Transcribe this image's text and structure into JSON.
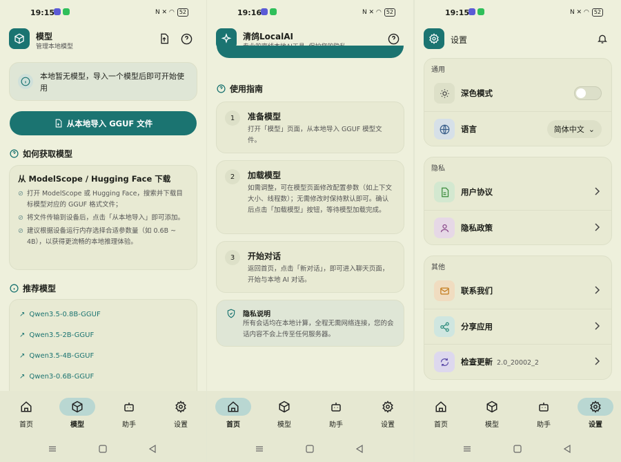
{
  "status": {
    "left_time": "19:15",
    "mid_time": "19:16",
    "right_time": "19:15",
    "battery": "52"
  },
  "screen1": {
    "title": "模型",
    "subtitle": "管理本地模型",
    "notice": "本地暂无模型，导入一个模型后即可开始使用",
    "import_button": "从本地导入 GGUF 文件",
    "how_title": "如何获取模型",
    "how_card_title": "从 ModelScope / Hugging Face 下载",
    "how_steps": [
      "打开 ModelScope 或 Hugging Face，搜索并下载目标模型对应的 GGUF 格式文件；",
      "将文件传输到设备后，点击「从本地导入」即可添加。",
      "建议根据设备运行内存选择合适参数量（如 0.6B ~ 4B），以获得更流畅的本地推理体验。"
    ],
    "recommend_title": "推荐模型",
    "models": [
      "Qwen3.5-0.8B-GGUF",
      "Qwen3.5-2B-GGUF",
      "Qwen3.5-4B-GGUF",
      "Qwen3-0.6B-GGUF"
    ]
  },
  "screen2": {
    "title": "清鸽LocalAI",
    "subtitle": "专业的离线本地AI工具, 保护您的隐私",
    "guide_title": "使用指南",
    "steps": [
      {
        "num": "1",
        "title": "准备模型",
        "desc": "打开「模型」页面，从本地导入 GGUF 模型文件。"
      },
      {
        "num": "2",
        "title": "加载模型",
        "desc": "如需调整，可在模型页面修改配置参数（如上下文大小、线程数）；无需修改时保持默认即可。确认后点击「加载模型」按钮，等待模型加载完成。"
      },
      {
        "num": "3",
        "title": "开始对话",
        "desc": "返回首页，点击「新对话」，即可进入聊天页面，开始与本地 AI 对话。"
      }
    ],
    "privacy_title": "隐私说明",
    "privacy_desc": "所有会话均在本地计算，全程无需网络连接，您的会话内容不会上传至任何服务器。"
  },
  "screen3": {
    "title": "设置",
    "general": "通用",
    "dark_mode": "深色模式",
    "language": "语言",
    "language_value": "简体中文",
    "privacy": "隐私",
    "user_agreement": "用户协议",
    "privacy_policy": "隐私政策",
    "other": "其他",
    "contact": "联系我们",
    "share": "分享应用",
    "update": "检查更新",
    "version": "2.0_20002_2"
  },
  "nav": {
    "home": "首页",
    "model": "模型",
    "assistant": "助手",
    "settings": "设置"
  },
  "colors": {
    "accent": "#1b7471",
    "background": "#eef0dc",
    "active_pill": "#b9d7d2"
  }
}
